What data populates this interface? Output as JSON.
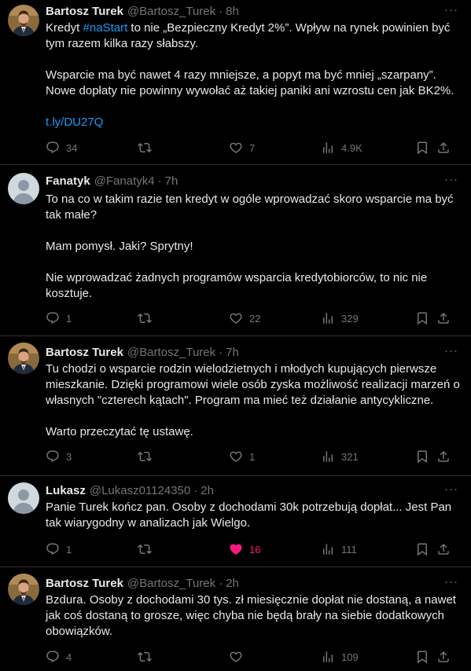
{
  "tweets": [
    {
      "name": "Bartosz Turek",
      "handle": "@Bartosz_Turek",
      "dot": "·",
      "time": "8h",
      "more": "···",
      "text_before_tag": "Kredyt ",
      "hashtag": "#naStart",
      "text_after_tag": " to nie „Bezpieczny Kredyt 2%”. Wpływ na rynek powinien być tym razem kilka razy słabszy.",
      "p2": "Wsparcie ma być nawet 4 razy mniejsze, a popyt ma być mniej „szarpany”. Nowe dopłaty nie powinny wywołać aż takiej paniki ani wzrostu cen jak BK2%.",
      "link": "t.ly/DU27Q",
      "replies": "34",
      "retweets": "",
      "likes": "7",
      "views": "4.9K"
    },
    {
      "name": "Fanatyk",
      "handle": "@Fanatyk4",
      "dot": "·",
      "time": "7h",
      "more": "···",
      "p1": "To na co w takim razie ten kredyt w ogóle wprowadzać skoro wsparcie ma być tak małe?",
      "p2": "Mam pomysł. Jaki? Sprytny!",
      "p3": "Nie wprowadzać żadnych programów wsparcia kredytobiorców, to nic nie kosztuje.",
      "replies": "1",
      "retweets": "",
      "likes": "22",
      "views": "329"
    },
    {
      "name": "Bartosz Turek",
      "handle": "@Bartosz_Turek",
      "dot": "·",
      "time": "7h",
      "more": "···",
      "p1": "Tu chodzi o wsparcie rodzin wielodzietnych i młodych kupujących pierwsze mieszkanie. Dzięki programowi wiele osób zyska możliwość realizacji marzeń o własnych \"czterech kątach\". Program ma mieć też działanie antycykliczne.",
      "p2": "Warto przeczytać tę ustawę.",
      "replies": "3",
      "retweets": "",
      "likes": "1",
      "views": "321"
    },
    {
      "name": "Lukasz",
      "handle": "@Lukasz01124350",
      "dot": "·",
      "time": "2h",
      "more": "···",
      "p1": "Panie Turek kończ pan. Osoby z dochodami 30k potrzebują dopłat... Jest Pan tak wiarygodny w analizach jak Wielgo.",
      "replies": "1",
      "retweets": "",
      "likes": "16",
      "views": "111"
    },
    {
      "name": "Bartosz Turek",
      "handle": "@Bartosz_Turek",
      "dot": "·",
      "time": "2h",
      "more": "···",
      "p1": "Bzdura. Osoby z dochodami 30 tys. zł miesięcznie dopłat nie dostaną, a nawet jak coś dostaną to grosze, więc chyba nie będą brały na siebie dodatkowych obowiązków.",
      "replies": "4",
      "retweets": "",
      "likes": "",
      "views": "109"
    }
  ],
  "colors": {
    "background": "#000000",
    "text": "#e7e9ea",
    "muted": "#71767b",
    "link": "#1d9bf0",
    "like_active": "#f91880",
    "divider": "#2f3336"
  },
  "icons": {
    "reply": "reply-icon",
    "retweet": "retweet-icon",
    "like": "heart-icon",
    "views": "views-icon",
    "bookmark": "bookmark-icon",
    "share": "share-icon"
  }
}
